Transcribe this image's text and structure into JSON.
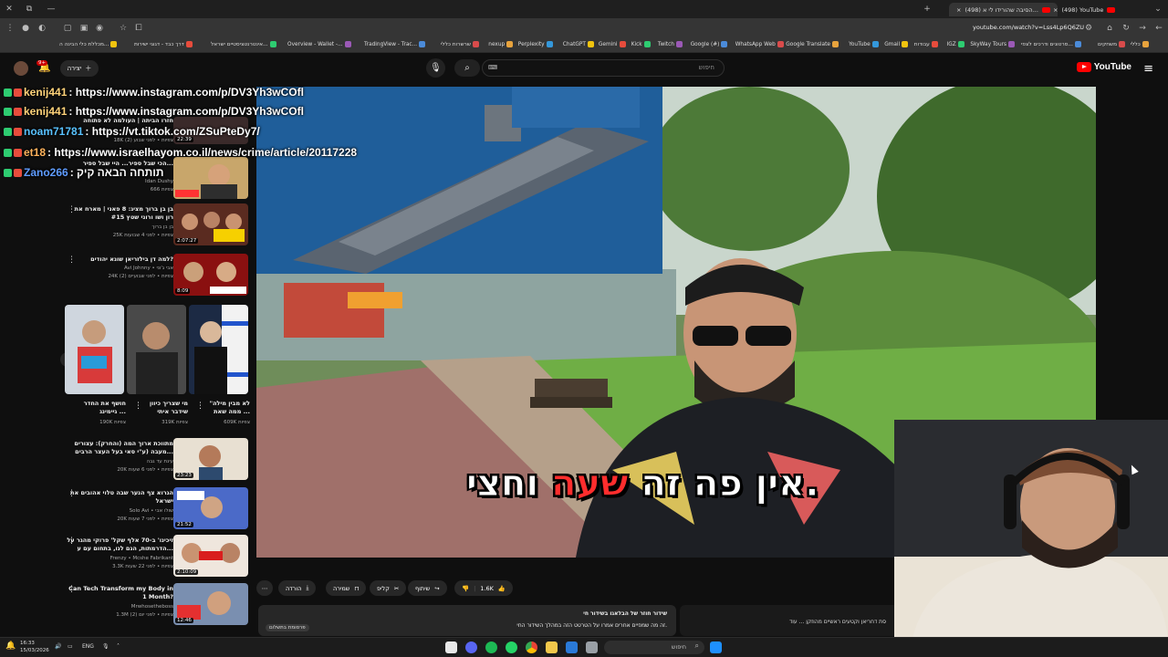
{
  "browser": {
    "tabs": [
      {
        "title": "(498) הסיבה שהורידו לי א...",
        "active": true
      },
      {
        "title": "(498) YouTube",
        "active": false
      }
    ],
    "url": "youtube.com/watch?v=Lss4Lp6Q6ZU",
    "bookmarks": [
      "כללי",
      "משחקים",
      "סרטונים ודרכים לצפי...",
      "SkyWay Tours",
      "IGZ",
      "עבודות",
      "Gmail",
      "YouTube",
      "Google Translate",
      "WhatsApp Web",
      "Google (#)",
      "Twitch",
      "Kick",
      "Gemini",
      "ChatGPT",
      "Perplexity",
      "nexup",
      "שרשרות כללי",
      "TradingView - Trac...",
      "Overview - Wallet -...",
      "אינטרנטציסטיים ישראל...",
      "דרך כבד - דגוגי ישירות",
      "מכללת כלי הבינה ה..."
    ]
  },
  "youtube": {
    "logo_text": "YouTube",
    "search_placeholder": "חיפוש",
    "create_label": "יצירה",
    "notifications_count": "9+"
  },
  "chat": [
    {
      "user": "kenij441",
      "text": ": https://www.instagram.com/p/DV3Yh3wCOfl",
      "color": "#ffd37a"
    },
    {
      "user": "kenij441",
      "text": ": https://www.instagram.com/p/DV3Yh3wCOfl",
      "color": "#ffd37a"
    },
    {
      "user": "noam71781",
      "text": ": https://vt.tiktok.com/ZSuPteDy7/",
      "color": "#59c2ff"
    },
    {
      "user": "et18",
      "text": ": https://www.israelhayom.co.il/news/crime/article/20117228",
      "color": "#ffb35c"
    },
    {
      "user": "Zano266",
      "text": ": תותחה הבאה קיק",
      "color": "#5f9cff"
    }
  ],
  "recommendations": [
    {
      "title": "חזרו הביתה | העולמה לא פתוחה",
      "channel": "",
      "views": "18K צפיות • לפני שבוע (2)",
      "duration": "22:39"
    },
    {
      "title": "הכי שבל ספיר... היי שבל ספיר...",
      "channel": "Idan Dushy",
      "views": "666 צפיות",
      "duration": ""
    },
    {
      "title": "בן בן ברוך מציג: 8 פאני | מארח את רון ושו ורוני שטץ #15",
      "channel": "בן בן ברוך",
      "views": "25K צפיות • לפני 4 שבועות",
      "duration": "2:07:27"
    },
    {
      "title": "למה דן בילזריאן שונא יהודים?",
      "channel": "Avi Johnny • אבי ג'וני",
      "views": "24K צפיות • לפני שבועיים (2)",
      "duration": "8:09"
    },
    {
      "title": "מתווכת ארוך המה (והחרק): עצורים מעבה (ע\"י סאי בעל העצר הרבים...",
      "channel": "עינת עד גבה",
      "views": "20K צפיות • לפני 6 שעות",
      "duration": "23:23"
    },
    {
      "title": "הגרוא צף הנער שבה טלוי אהובים את ישראל",
      "channel": "Solo Avi • שולו אבי",
      "views": "20K צפיות • לפני 7 שעות",
      "duration": "21:52"
    },
    {
      "title": "זיכינו' ב-70 אלף שקל' פרוקי מהגר על הדרמתות, הגם לנו, בתחום עם ע...",
      "channel": "Frenzy • Mcshe Fabrikant",
      "views": "3.3K צפיות • לפני 22 שעות",
      "duration": "2:10:09"
    },
    {
      "title": "Can Tech Transform my Body in 1 Month?",
      "channel": "Mrwhosetheboss",
      "views": "1.3M צפיות • לפני יום (2)",
      "duration": "12:46"
    }
  ],
  "shorts": [
    {
      "title": "חושף את החדר גיימינג ...",
      "views": "190K צפיות"
    },
    {
      "title": "מי שצריך כיוון שידבר איתי",
      "views": "319K צפיות"
    },
    {
      "title": "\"לא מבין מילה ממה שאת ...",
      "views": "609K צפיות"
    }
  ],
  "player": {
    "subtitle_white_1": "אין פה זה ",
    "subtitle_red": "שעה",
    "subtitle_white_2": " וחצי."
  },
  "actions": {
    "likes": "1.6K",
    "dislike": "",
    "share": "שיתוף",
    "clip": "קליפ",
    "save": "שמירה",
    "download": "הורדה",
    "more": "⋯"
  },
  "description": {
    "line1": "שידור חוזר של הבלאגו בשידור חי",
    "line2": "זה מה שמפיים אחרים אמרו על הטרטט הזה במהלך השידור החי.",
    "chip": "פרסומת בתשלום"
  },
  "comment_preview": "סת דחריאן וקטעים ראשיים מהוזקן ... עוד",
  "taskbar": {
    "time": "16:33",
    "date": "15/03/2026",
    "lang": "ENG",
    "search_label": "חיפוש"
  }
}
